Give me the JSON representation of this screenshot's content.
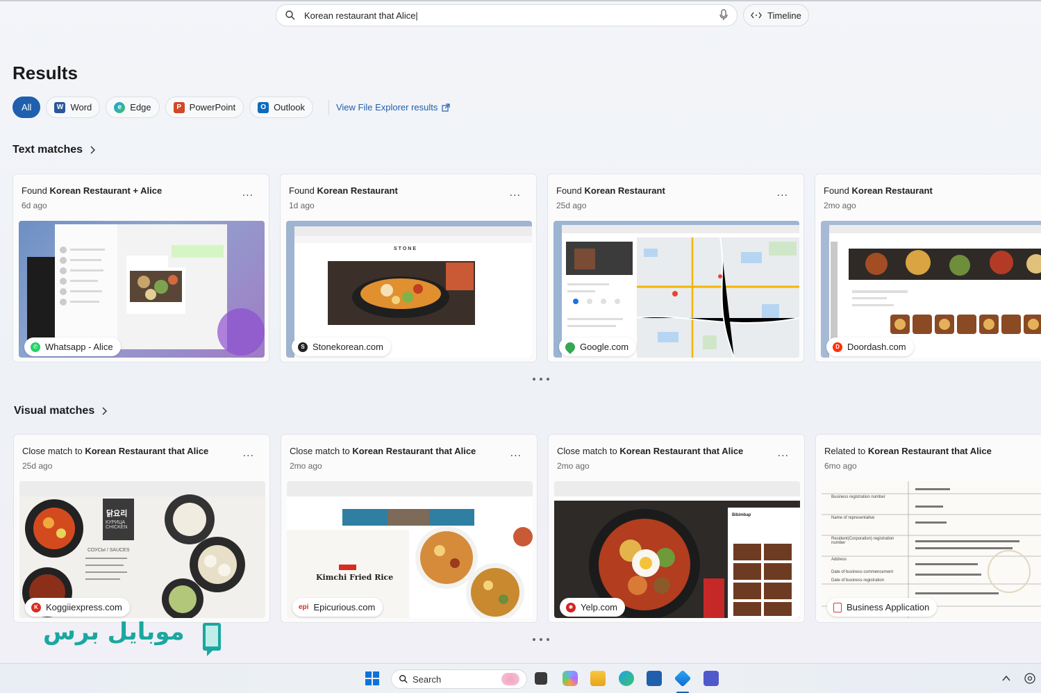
{
  "search": {
    "query": "Korean restaurant that Alice|"
  },
  "timeline_label": "Timeline",
  "results_title": "Results",
  "filters": [
    {
      "label": "All",
      "icon": ""
    },
    {
      "label": "Word",
      "icon": "word-icon"
    },
    {
      "label": "Edge",
      "icon": "edge-icon"
    },
    {
      "label": "PowerPoint",
      "icon": "powerpoint-icon"
    },
    {
      "label": "Outlook",
      "icon": "outlook-icon"
    }
  ],
  "view_file_explorer": "View File Explorer results",
  "text_matches": {
    "title": "Text matches",
    "cards": [
      {
        "prefix": "Found ",
        "bold": "Korean Restaurant + Alice",
        "age": "6d ago",
        "source": "Whatsapp - Alice",
        "source_icon": "whatsapp-icon"
      },
      {
        "prefix": "Found ",
        "bold": "Korean Restaurant",
        "age": "1d ago",
        "source": "Stonekorean.com",
        "source_icon": "stone-icon"
      },
      {
        "prefix": "Found ",
        "bold": "Korean Restaurant",
        "age": "25d ago",
        "source": "Google.com",
        "source_icon": "maps-pin-icon"
      },
      {
        "prefix": "Found ",
        "bold": "Korean Restaurant",
        "age": "2mo ago",
        "source": "Doordash.com",
        "source_icon": "doordash-icon"
      }
    ]
  },
  "visual_matches": {
    "title": "Visual matches",
    "cards": [
      {
        "prefix": "Close match to ",
        "bold": "Korean Restaurant that Alice",
        "age": "25d ago",
        "source": "Koggiiexpress.com",
        "source_icon": "kogi-icon"
      },
      {
        "prefix": "Close match to ",
        "bold": "Korean Restaurant that Alice",
        "age": "2mo ago",
        "source": "Epicurious.com",
        "source_icon": "epi-icon"
      },
      {
        "prefix": "Close match to ",
        "bold": "Korean Restaurant that Alice",
        "age": "2mo ago",
        "source": "Yelp.com",
        "source_icon": "yelp-icon"
      },
      {
        "prefix": "Related to ",
        "bold": "Korean Restaurant that Alice",
        "age": "6mo ago",
        "source": "Business Application",
        "source_icon": "pdf-icon"
      }
    ]
  },
  "thumb_text": {
    "stone": "STONE",
    "kimchi": "Kimchi Fried Rice",
    "bibimbap": "Bibimbap",
    "kogi_title": "닭요리",
    "kogi_sub": "КУРИЦА CHICKEN",
    "kogi_sauces": "СОУСЫ / SAUCES",
    "biz_lines": [
      "Business registration number",
      "Name of representative",
      "Resident(Corporation) registration number",
      "Address",
      "Date of business commencement",
      "Date of business registration"
    ]
  },
  "more_label": "...",
  "taskbar": {
    "search_label": "Search"
  },
  "watermark": "موبایل برس"
}
